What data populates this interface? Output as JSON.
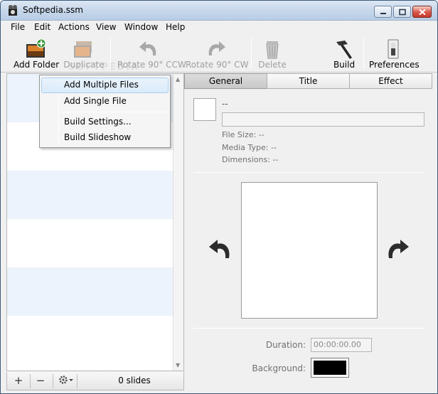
{
  "window": {
    "title": "Softpedia.ssm"
  },
  "menubar": {
    "items": [
      "File",
      "Edit",
      "Actions",
      "View",
      "Window",
      "Help"
    ]
  },
  "toolbar": {
    "add_folder": "Add Folder",
    "duplicate": "Duplicate",
    "rotate_ccw": "Rotate 90° CCW",
    "rotate_cw": "Rotate 90° CW",
    "delete": "Delete",
    "build": "Build",
    "preferences": "Preferences",
    "watermark": "SOFTPEDIA"
  },
  "dropdown": {
    "items": [
      "Add Multiple Files",
      "Add Single File",
      "Build Settings...",
      "Build Slideshow"
    ],
    "highlighted": "Add Multiple Files"
  },
  "bottom_bar": {
    "add": "+",
    "remove": "−",
    "slides": "0 slides"
  },
  "tabs": [
    "General",
    "Title",
    "Effect"
  ],
  "general": {
    "file_title": "--",
    "file_size": "File Size: --",
    "media_type": "Media Type: --",
    "dimensions": "Dimensions: --",
    "duration_label": "Duration:",
    "duration_value": "00:00:00.00",
    "background_label": "Background:",
    "background_color": "#000000"
  },
  "colors": {
    "stripe_blue": "#edf3fc",
    "accent": "#a8d0f5"
  }
}
